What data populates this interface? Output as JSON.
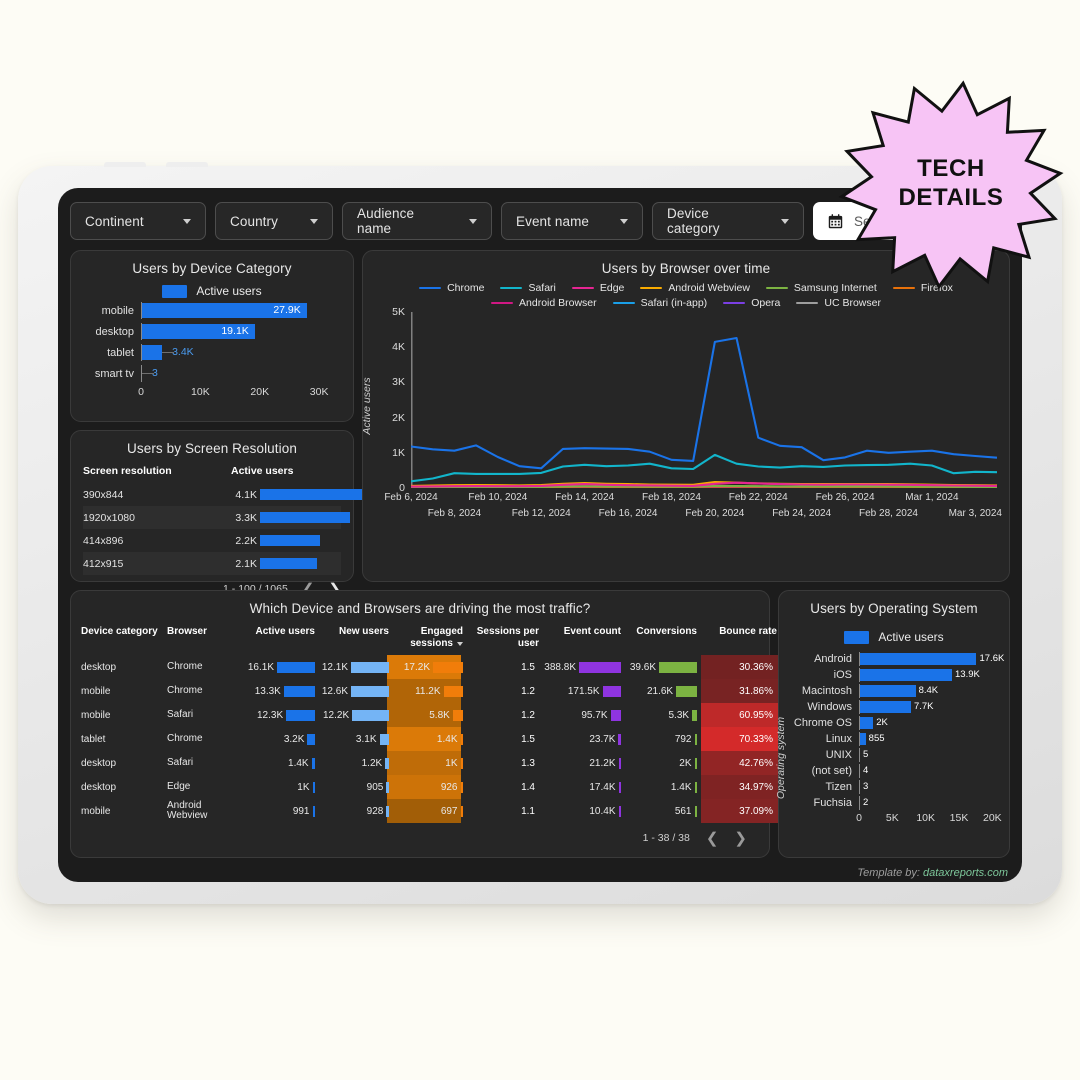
{
  "background_color": "#fdfcf5",
  "badge": {
    "line1": "TECH",
    "line2": "DETAILS",
    "fill_color": "#f7c4f5",
    "stroke_color": "#111111"
  },
  "filters": {
    "chips": [
      {
        "label": "Continent"
      },
      {
        "label": "Country"
      },
      {
        "label": "Audience name"
      },
      {
        "label": "Event name"
      },
      {
        "label": "Device category"
      }
    ],
    "date_picker": {
      "icon": "calendar-icon",
      "label": "Select"
    }
  },
  "device_card": {
    "title": "Users by Device Category",
    "legend": "Active users",
    "chart_data": {
      "type": "bar",
      "orientation": "horizontal",
      "title": "Users by Device Category",
      "xlabel": "",
      "ylabel": "",
      "series_name": "Active users",
      "categories": [
        "mobile",
        "desktop",
        "tablet",
        "smart tv"
      ],
      "values": [
        27900,
        19100,
        3400,
        3
      ],
      "labels": [
        "27.9K",
        "19.1K",
        "3.4K",
        "3"
      ],
      "label_inside": [
        true,
        true,
        false,
        false
      ],
      "xlim": [
        0,
        32000
      ],
      "xticks": [
        0,
        10000,
        20000,
        30000
      ],
      "xticklabels": [
        "0",
        "10K",
        "20K",
        "30K"
      ],
      "bar_color": "#1a73e8"
    }
  },
  "resolution_card": {
    "title": "Users by Screen Resolution",
    "columns": [
      "Screen resolution",
      "Active users"
    ],
    "sort_column": "Active users",
    "chart_data": {
      "type": "table",
      "title": "Users by Screen Resolution",
      "categories": [
        "390x844",
        "1920x1080",
        "414x896",
        "412x915"
      ],
      "values": [
        4100,
        3300,
        2200,
        2100
      ],
      "labels": [
        "4.1K",
        "3.3K",
        "2.2K",
        "2.1K"
      ],
      "max": 4100,
      "bar_color": "#1a73e8"
    },
    "pagination": "1 - 100 / 1065"
  },
  "browser_card": {
    "title": "Users by Browser over time",
    "chart_data": {
      "type": "line",
      "title": "Users by Browser over time",
      "xlabel": "",
      "ylabel": "Active users",
      "ylim": [
        0,
        5000
      ],
      "yticks": [
        0,
        1000,
        2000,
        3000,
        4000,
        5000
      ],
      "yticklabels": [
        "0",
        "1K",
        "2K",
        "3K",
        "4K",
        "5K"
      ],
      "grid": false,
      "legend_position": "top",
      "x": [
        "Feb 6, 2024",
        "Feb 7, 2024",
        "Feb 8, 2024",
        "Feb 9, 2024",
        "Feb 10, 2024",
        "Feb 11, 2024",
        "Feb 12, 2024",
        "Feb 13, 2024",
        "Feb 14, 2024",
        "Feb 15, 2024",
        "Feb 16, 2024",
        "Feb 17, 2024",
        "Feb 18, 2024",
        "Feb 19, 2024",
        "Feb 20, 2024",
        "Feb 21, 2024",
        "Feb 22, 2024",
        "Feb 23, 2024",
        "Feb 24, 2024",
        "Feb 25, 2024",
        "Feb 26, 2024",
        "Feb 27, 2024",
        "Feb 28, 2024",
        "Feb 29, 2024",
        "Mar 1, 2024",
        "Mar 2, 2024",
        "Mar 3, 2024",
        "Mar 4, 2024"
      ],
      "xticklabels_top": [
        "Feb 6, 2024",
        "Feb 10, 2024",
        "Feb 14, 2024",
        "Feb 18, 2024",
        "Feb 22, 2024",
        "Feb 26, 2024",
        "Mar 1, 2024"
      ],
      "xticklabels_bottom": [
        "Feb 8, 2024",
        "Feb 12, 2024",
        "Feb 16, 2024",
        "Feb 20, 2024",
        "Feb 24, 2024",
        "Feb 28, 2024",
        "Mar 3, 2024"
      ],
      "series": [
        {
          "name": "Chrome",
          "color": "#1a73e8",
          "values": [
            1180,
            1100,
            1060,
            1210,
            880,
            620,
            560,
            1110,
            1130,
            1120,
            1110,
            1030,
            800,
            770,
            4150,
            4260,
            1430,
            1200,
            1160,
            790,
            870,
            1060,
            1000,
            1030,
            1060,
            960,
            910,
            860
          ]
        },
        {
          "name": "Safari",
          "color": "#12b5cb",
          "values": [
            190,
            270,
            420,
            400,
            400,
            400,
            430,
            610,
            660,
            620,
            640,
            690,
            560,
            540,
            940,
            690,
            610,
            580,
            620,
            600,
            640,
            650,
            660,
            690,
            640,
            420,
            460,
            450
          ]
        },
        {
          "name": "Edge",
          "color": "#e52592",
          "values": [
            40,
            45,
            50,
            55,
            50,
            50,
            60,
            90,
            110,
            90,
            80,
            75,
            65,
            60,
            120,
            150,
            130,
            110,
            100,
            95,
            100,
            100,
            95,
            90,
            80,
            70,
            65,
            60
          ]
        },
        {
          "name": "Android Webview",
          "color": "#f9ab00",
          "values": [
            60,
            70,
            80,
            85,
            80,
            75,
            85,
            120,
            140,
            120,
            110,
            100,
            95,
            90,
            170,
            150,
            130,
            120,
            115,
            110,
            115,
            115,
            110,
            105,
            95,
            85,
            80,
            75
          ]
        },
        {
          "name": "Samsung Internet",
          "color": "#7cb342",
          "values": [
            25,
            28,
            30,
            32,
            30,
            28,
            32,
            45,
            50,
            45,
            42,
            40,
            38,
            36,
            60,
            55,
            50,
            46,
            44,
            42,
            44,
            44,
            42,
            40,
            36,
            33,
            31,
            30
          ]
        },
        {
          "name": "Firefox",
          "color": "#e8710a",
          "values": [
            20,
            22,
            24,
            25,
            24,
            22,
            25,
            35,
            40,
            35,
            33,
            31,
            30,
            28,
            48,
            44,
            40,
            37,
            35,
            34,
            35,
            35,
            33,
            32,
            29,
            26,
            25,
            24
          ]
        },
        {
          "name": "Android Browser",
          "color": "#d01884",
          "values": [
            12,
            13,
            14,
            15,
            14,
            13,
            15,
            20,
            23,
            20,
            19,
            18,
            17,
            16,
            28,
            25,
            23,
            21,
            20,
            19,
            20,
            20,
            19,
            18,
            17,
            15,
            14,
            14
          ]
        },
        {
          "name": "Safari (in-app)",
          "color": "#1a9fe8",
          "values": [
            10,
            11,
            12,
            12,
            11,
            11,
            12,
            17,
            19,
            17,
            16,
            15,
            14,
            13,
            23,
            21,
            19,
            17,
            16,
            16,
            16,
            16,
            16,
            15,
            14,
            12,
            12,
            11
          ]
        },
        {
          "name": "Opera",
          "color": "#7b3fe4",
          "values": [
            6,
            6,
            7,
            7,
            7,
            6,
            7,
            10,
            11,
            10,
            9,
            9,
            8,
            8,
            13,
            12,
            11,
            10,
            10,
            9,
            10,
            10,
            9,
            9,
            8,
            7,
            7,
            7
          ]
        },
        {
          "name": "UC Browser",
          "color": "#9e9e9e",
          "values": [
            3,
            3,
            3,
            4,
            3,
            3,
            4,
            5,
            6,
            5,
            5,
            4,
            4,
            4,
            7,
            6,
            6,
            5,
            5,
            5,
            5,
            5,
            5,
            4,
            4,
            4,
            4,
            3
          ]
        }
      ]
    }
  },
  "traffic_table": {
    "title": "Which Device and Browsers are driving the most traffic?",
    "sort_column": "Engaged sessions",
    "columns": [
      {
        "label": "Device category",
        "align": "left"
      },
      {
        "label": "Browser",
        "align": "left"
      },
      {
        "label": "Active users",
        "align": "right"
      },
      {
        "label": "New users",
        "align": "right"
      },
      {
        "label": "Engaged sessions",
        "align": "right"
      },
      {
        "label": "Sessions per user",
        "align": "right"
      },
      {
        "label": "Event count",
        "align": "right"
      },
      {
        "label": "Conversions",
        "align": "right"
      },
      {
        "label": "Bounce rate",
        "align": "right"
      }
    ],
    "rows": [
      {
        "device": "desktop",
        "browser": "Chrome",
        "active_users": "16.1K",
        "active_frac": 1.0,
        "new_users": "12.1K",
        "new_frac": 1.0,
        "engaged": "17.2K",
        "engaged_frac": 1.0,
        "spu": "1.5",
        "spu_frac": 0.82,
        "events": "388.8K",
        "events_frac": 1.0,
        "conversions": "39.6K",
        "conv_frac": 1.0,
        "bounce": "30.36%",
        "bounce_frac": 0.3
      },
      {
        "device": "mobile",
        "browser": "Chrome",
        "active_users": "13.3K",
        "active_frac": 0.82,
        "new_users": "12.6K",
        "new_frac": 1.0,
        "engaged": "11.2K",
        "engaged_frac": 0.65,
        "spu": "1.2",
        "spu_frac": 0.55,
        "events": "171.5K",
        "events_frac": 0.44,
        "conversions": "21.6K",
        "conv_frac": 0.55,
        "bounce": "31.86%",
        "bounce_frac": 0.32
      },
      {
        "device": "mobile",
        "browser": "Safari",
        "active_users": "12.3K",
        "active_frac": 0.76,
        "new_users": "12.2K",
        "new_frac": 0.97,
        "engaged": "5.8K",
        "engaged_frac": 0.34,
        "spu": "1.2",
        "spu_frac": 0.55,
        "events": "95.7K",
        "events_frac": 0.25,
        "conversions": "5.3K",
        "conv_frac": 0.13,
        "bounce": "60.95%",
        "bounce_frac": 0.61
      },
      {
        "device": "tablet",
        "browser": "Chrome",
        "active_users": "3.2K",
        "active_frac": 0.2,
        "new_users": "3.1K",
        "new_frac": 0.25,
        "engaged": "1.4K",
        "engaged_frac": 0.08,
        "spu": "1.5",
        "spu_frac": 0.82,
        "events": "23.7K",
        "events_frac": 0.06,
        "conversions": "792",
        "conv_frac": 0.02,
        "bounce": "70.33%",
        "bounce_frac": 0.7
      },
      {
        "device": "desktop",
        "browser": "Safari",
        "active_users": "1.4K",
        "active_frac": 0.09,
        "new_users": "1.2K",
        "new_frac": 0.1,
        "engaged": "1K",
        "engaged_frac": 0.06,
        "spu": "1.3",
        "spu_frac": 0.64,
        "events": "21.2K",
        "events_frac": 0.05,
        "conversions": "2K",
        "conv_frac": 0.05,
        "bounce": "42.76%",
        "bounce_frac": 0.43
      },
      {
        "device": "desktop",
        "browser": "Edge",
        "active_users": "1K",
        "active_frac": 0.06,
        "new_users": "905",
        "new_frac": 0.07,
        "engaged": "926",
        "engaged_frac": 0.05,
        "spu": "1.4",
        "spu_frac": 0.73,
        "events": "17.4K",
        "events_frac": 0.04,
        "conversions": "1.4K",
        "conv_frac": 0.04,
        "bounce": "34.97%",
        "bounce_frac": 0.35
      },
      {
        "device": "mobile",
        "browser": "Android Webview",
        "active_users": "991",
        "active_frac": 0.06,
        "new_users": "928",
        "new_frac": 0.07,
        "engaged": "697",
        "engaged_frac": 0.04,
        "spu": "1.1",
        "spu_frac": 0.45,
        "events": "10.4K",
        "events_frac": 0.03,
        "conversions": "561",
        "conv_frac": 0.02,
        "bounce": "37.09%",
        "bounce_frac": 0.37
      }
    ],
    "pagination": "1 - 38 / 38",
    "bar_colors": {
      "active_users": "#1a73e8",
      "new_users": "#74b4f5",
      "engaged_sessions": "#f17d0a",
      "event_count": "#8f34e0",
      "conversions": "#7cb342"
    },
    "heat_colors": {
      "sessions_per_user_low": "#9a5a07",
      "sessions_per_user_high": "#e07c08",
      "bounce_low": "#6e2222",
      "bounce_high": "#db2b2b"
    }
  },
  "os_card": {
    "title": "Users by Operating System",
    "legend": "Active users",
    "chart_data": {
      "type": "bar",
      "orientation": "horizontal",
      "title": "Users by Operating System",
      "ylabel": "Operating system",
      "series_name": "Active users",
      "categories": [
        "Android",
        "iOS",
        "Macintosh",
        "Windows",
        "Chrome OS",
        "Linux",
        "UNIX",
        "(not set)",
        "Tizen",
        "Fuchsia"
      ],
      "values": [
        17600,
        13900,
        8400,
        7700,
        2000,
        855,
        5,
        4,
        3,
        2
      ],
      "labels": [
        "17.6K",
        "13.9K",
        "8.4K",
        "7.7K",
        "2K",
        "855",
        "5",
        "4",
        "3",
        "2"
      ],
      "xlim": [
        0,
        21000
      ],
      "xticks": [
        0,
        5000,
        10000,
        15000,
        20000
      ],
      "xticklabels": [
        "0",
        "5K",
        "10K",
        "15K",
        "20K"
      ],
      "bar_color": "#1a73e8"
    }
  },
  "footer": {
    "prefix": "Template by: ",
    "link": "dataxreports.com"
  }
}
